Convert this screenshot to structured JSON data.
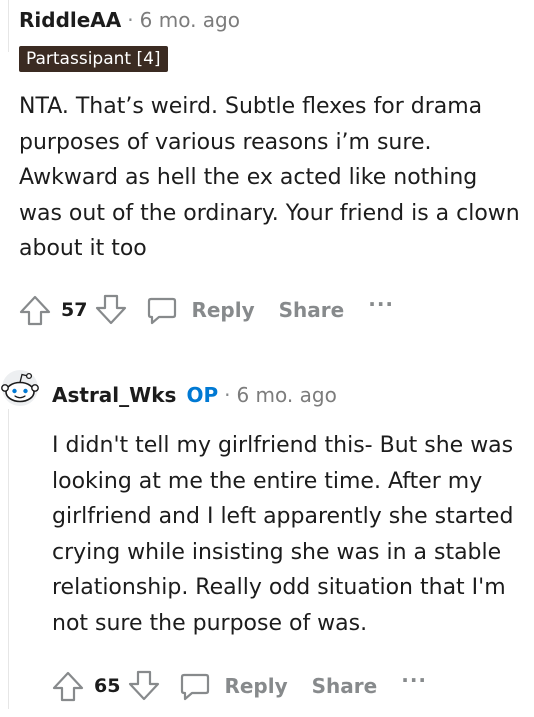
{
  "comment1": {
    "username": "RiddleAA",
    "separator": "·",
    "time": "6 mo. ago",
    "flair": "Partassipant [4]",
    "body": "NTA. That’s weird. Subtle flexes for drama purposes of various reasons i’m sure. Awkward as hell the ex acted like nothing was out of the ordinary. Your friend is a clown about it too",
    "votes": "57",
    "reply_label": "Reply",
    "share_label": "Share",
    "more_label": "···"
  },
  "comment2": {
    "username": "Astral_Wks",
    "op_tag": "OP",
    "separator": "·",
    "time": "6 mo. ago",
    "body": "I didn't tell my girlfriend this- But she was looking at me the entire time. After my girlfriend and I left apparently she started crying while insisting she was in a stable relationship. Really odd situation that I'm not sure the purpose of was.",
    "votes": "65",
    "reply_label": "Reply",
    "share_label": "Share",
    "more_label": "···"
  },
  "colors": {
    "flair_bg": "#3b2b22",
    "op_blue": "#0079d3",
    "muted": "#878a8c",
    "text": "#1c1c1c"
  }
}
